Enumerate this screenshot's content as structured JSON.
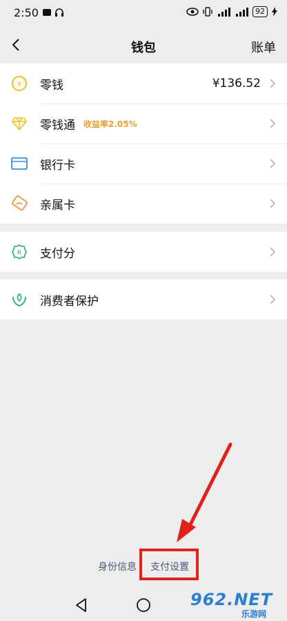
{
  "status": {
    "time": "2:50",
    "battery": "92"
  },
  "header": {
    "title": "钱包",
    "bill": "账单"
  },
  "group1": [
    {
      "label": "零钱",
      "value": "¥136.52"
    },
    {
      "label": "零钱通",
      "badge": "收益率2.05%"
    },
    {
      "label": "银行卡"
    },
    {
      "label": "亲属卡"
    }
  ],
  "group2": [
    {
      "label": "支付分"
    }
  ],
  "group3": [
    {
      "label": "消费者保护"
    }
  ],
  "footer": {
    "identity": "身份信息",
    "settings": "支付设置"
  },
  "watermark": {
    "logo": "962.NET",
    "site": "乐游网"
  },
  "colors": {
    "accent": "#e8a033",
    "link": "#4a5b7a",
    "highlight": "#e0221b",
    "brand_green": "#07c160"
  }
}
